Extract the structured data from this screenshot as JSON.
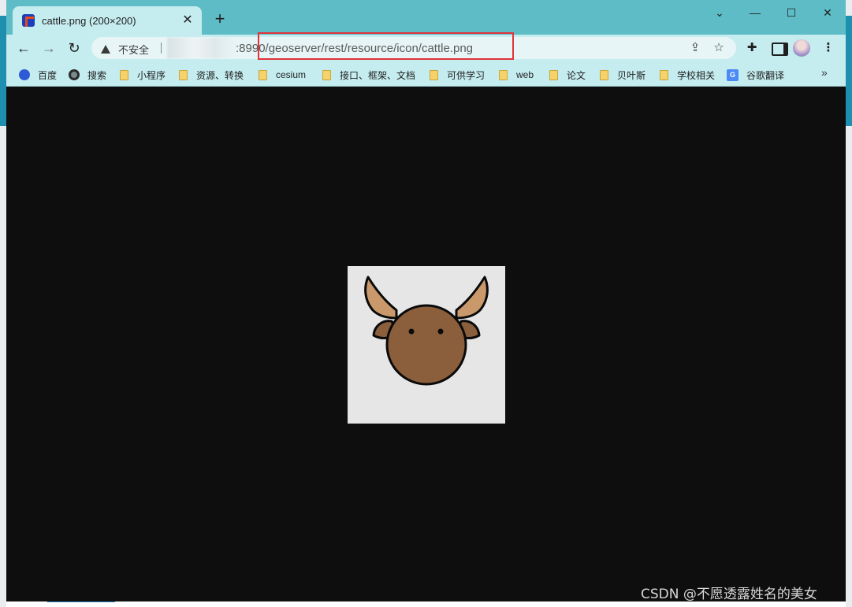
{
  "tab": {
    "title": "cattle.png (200×200)",
    "close_glyph": "✕"
  },
  "new_tab_glyph": "+",
  "window_controls": {
    "dropdown": "⌄",
    "minimize": "—",
    "maximize": "☐",
    "close": "✕"
  },
  "toolbar": {
    "back": "←",
    "forward": "→",
    "reload": "↻",
    "security_label": "不安全",
    "url": ":8990/geoserver/rest/resource/icon/cattle.png",
    "share": "⇪",
    "star": "☆",
    "extensions": "✚",
    "menu": "⋮"
  },
  "bookmarks": [
    {
      "label": "百度",
      "icon": "baidu-icon"
    },
    {
      "label": "搜索",
      "icon": "globe-icon"
    },
    {
      "label": "小程序",
      "icon": "folder-icon"
    },
    {
      "label": "资源、转换",
      "icon": "folder-icon"
    },
    {
      "label": "cesium",
      "icon": "folder-icon"
    },
    {
      "label": "接口、框架、文档",
      "icon": "folder-icon"
    },
    {
      "label": "可供学习",
      "icon": "folder-icon"
    },
    {
      "label": "web",
      "icon": "folder-icon"
    },
    {
      "label": "论文",
      "icon": "folder-icon"
    },
    {
      "label": "贝叶斯",
      "icon": "folder-icon"
    },
    {
      "label": "学校相关",
      "icon": "folder-icon"
    },
    {
      "label": "谷歌翻译",
      "icon": "google-translate-icon"
    }
  ],
  "bookmarks_more": "»",
  "image": {
    "alt_subject": "cattle-head",
    "colors": {
      "background": "#e6e6e6",
      "head": "#8b5e3c",
      "horn": "#c9996b",
      "outline": "#0a0a0a"
    }
  },
  "watermark": "CSDN @不愿透露姓名的美女",
  "colors": {
    "titlebar": "#5ebcc6",
    "toolbar": "#c5ecef",
    "content_bg": "#0e0e0e",
    "url_highlight": "#e0333a"
  }
}
